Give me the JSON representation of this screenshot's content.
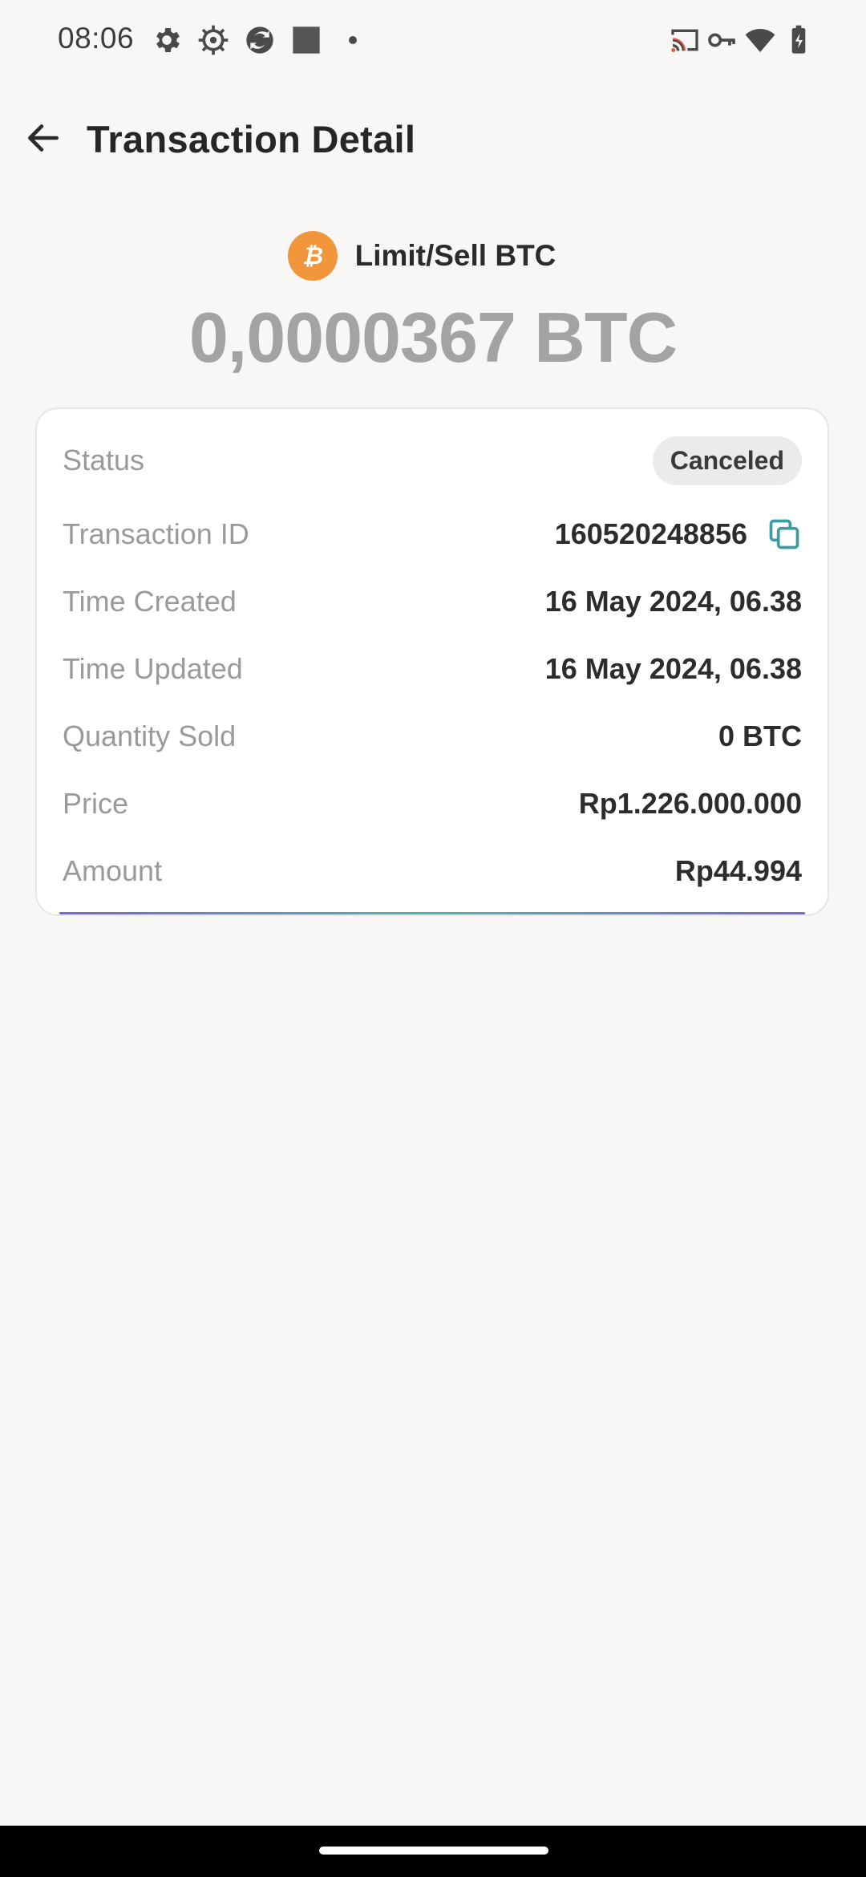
{
  "status_bar": {
    "time": "08:06",
    "icons": [
      "settings-icon",
      "cog-icon",
      "sync-app-icon",
      "square-app-icon",
      "dot-icon",
      "cast-icon",
      "vpn-key-icon",
      "wifi-icon",
      "battery-icon"
    ]
  },
  "header": {
    "title": "Transaction Detail",
    "back_icon": "arrow-left-icon"
  },
  "summary": {
    "pair_label": "Limit/Sell BTC",
    "coin_icon": "bitcoin-icon",
    "coin_color": "#f1963a",
    "amount": "0,0000367 BTC"
  },
  "details": {
    "status_label": "Status",
    "status_value": "Canceled",
    "transaction_id_label": "Transaction ID",
    "transaction_id_value": "160520248856",
    "time_created_label": "Time Created",
    "time_created_value": "16 May 2024, 06.38",
    "time_updated_label": "Time Updated",
    "time_updated_value": "16 May 2024, 06.38",
    "quantity_sold_label": "Quantity Sold",
    "quantity_sold_value": "0 BTC",
    "price_label": "Price",
    "price_value": "Rp1.226.000.000",
    "amount_label": "Amount",
    "amount_value": "Rp44.994"
  },
  "colors": {
    "background": "#f8f7f6",
    "accent_teal": "#3a9ea0",
    "muted_text": "#9a9a9a"
  }
}
